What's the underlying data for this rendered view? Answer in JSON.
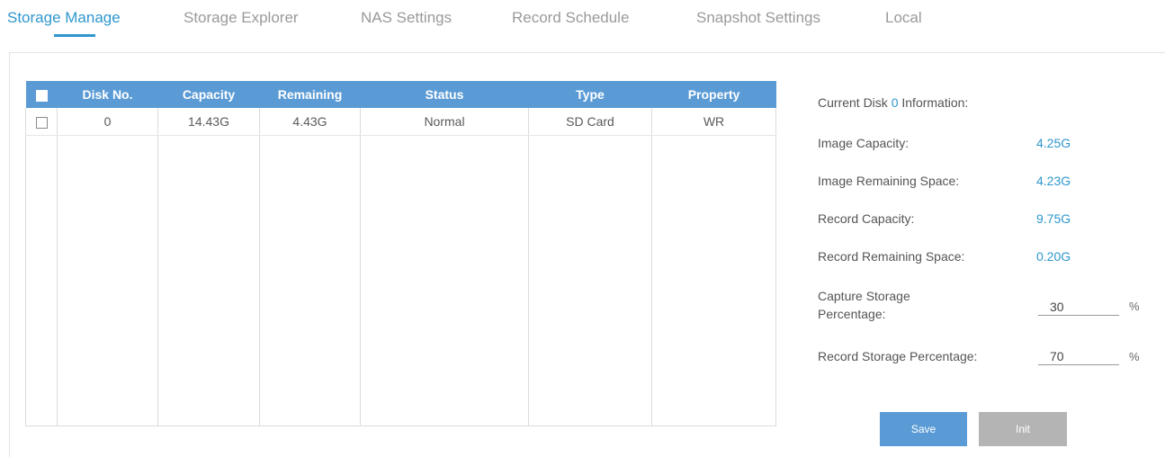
{
  "tabs": [
    {
      "label": "Storage Manage",
      "active": true
    },
    {
      "label": "Storage Explorer",
      "active": false
    },
    {
      "label": "NAS Settings",
      "active": false
    },
    {
      "label": "Record Schedule",
      "active": false
    },
    {
      "label": "Snapshot Settings",
      "active": false
    },
    {
      "label": "Local",
      "active": false
    }
  ],
  "disk_table": {
    "headers": [
      "Disk No.",
      "Capacity",
      "Remaining",
      "Status",
      "Type",
      "Property"
    ],
    "rows": [
      {
        "disk_no": "0",
        "capacity": "14.43G",
        "remaining": "4.43G",
        "status": "Normal",
        "type": "SD Card",
        "property": "WR",
        "checked": false
      }
    ]
  },
  "info": {
    "heading_prefix": "Current Disk ",
    "disk_number": "0",
    "heading_suffix": " Information:",
    "image_capacity_label": "Image Capacity:",
    "image_capacity_value": "4.25G",
    "image_remaining_label": "Image Remaining Space:",
    "image_remaining_value": "4.23G",
    "record_capacity_label": "Record Capacity:",
    "record_capacity_value": "9.75G",
    "record_remaining_label": "Record Remaining Space:",
    "record_remaining_value": "0.20G",
    "capture_pct_label": "Capture Storage Percentage:",
    "capture_pct_value": "30",
    "record_pct_label": "Record Storage Percentage:",
    "record_pct_value": "70",
    "percent_sign": "%"
  },
  "buttons": {
    "save": "Save",
    "init": "Init"
  },
  "colors": {
    "accent": "#2f97cc",
    "header_bg": "#5b9bd5",
    "disabled_btn": "#b4b4b4"
  }
}
